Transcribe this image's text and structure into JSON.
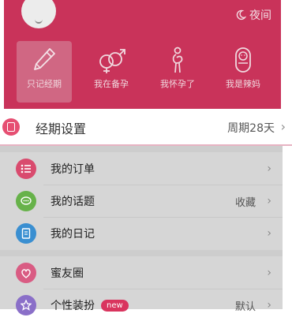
{
  "header": {
    "night_label": "夜间",
    "modes": [
      {
        "label": "只记经期",
        "icon": "pen-icon",
        "active": true
      },
      {
        "label": "我在备孕",
        "icon": "gender-icon",
        "active": false
      },
      {
        "label": "我怀孕了",
        "icon": "pregnant-icon",
        "active": false
      },
      {
        "label": "我是辣妈",
        "icon": "baby-icon",
        "active": false
      }
    ]
  },
  "period_setting": {
    "label": "经期设置",
    "value": "周期28天"
  },
  "menu": {
    "items": [
      {
        "label": "我的订单",
        "icon": "order-list-icon",
        "color": "#d94b6e"
      },
      {
        "label": "我的话题",
        "icon": "chat-bubble-icon",
        "color": "#67b24a",
        "value": "收藏"
      },
      {
        "label": "我的日记",
        "icon": "diary-icon",
        "color": "#3a8fd1"
      },
      {
        "label": "蜜友圈",
        "icon": "heart-circle-icon",
        "color": "#d95c83"
      },
      {
        "label": "个性装扮",
        "icon": "star-icon",
        "color": "#8a6fc8",
        "badge": "new",
        "value": "默认"
      }
    ]
  },
  "colors": {
    "brand": "#c9335a",
    "accent": "#e64f72"
  }
}
